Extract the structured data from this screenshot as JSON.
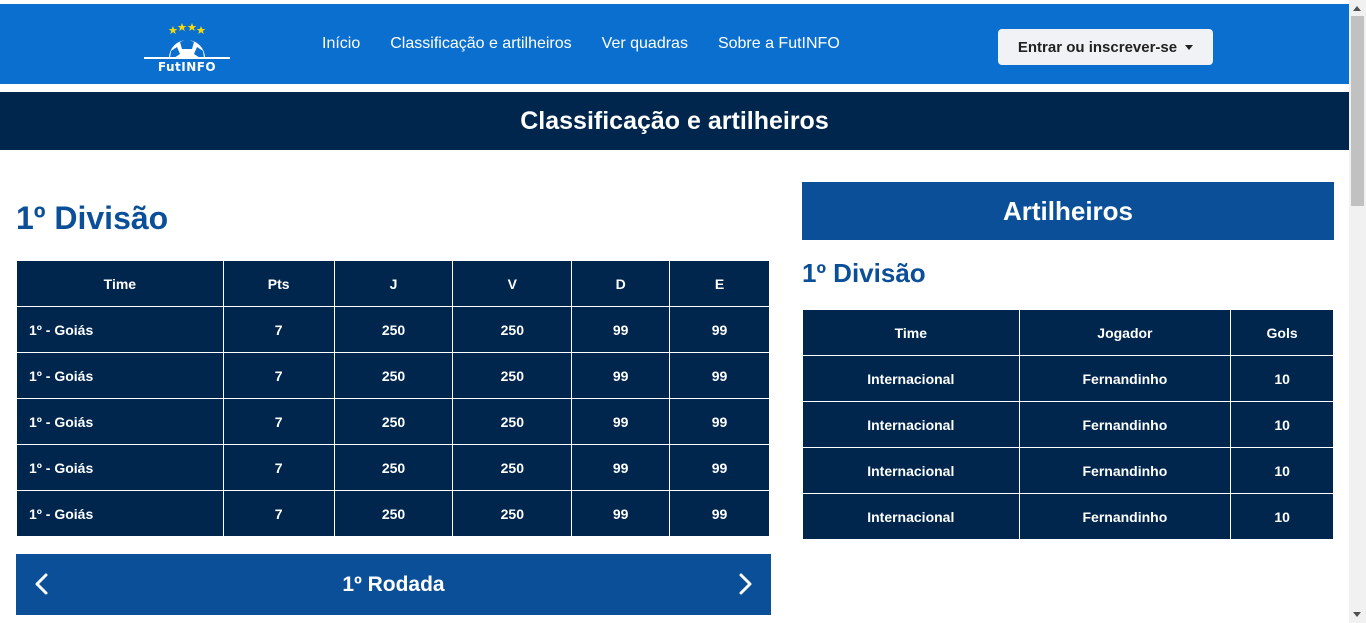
{
  "navbar": {
    "logo_text": "FutINFO",
    "links": [
      "Início",
      "Classificação e artilheiros",
      "Ver quadras",
      "Sobre a FutINFO"
    ],
    "login_label": "Entrar ou inscrever-se"
  },
  "page_title": "Classificação e artilheiros",
  "standings": {
    "division_title": "1º Divisão",
    "headers": [
      "Time",
      "Pts",
      "J",
      "V",
      "D",
      "E"
    ],
    "rows": [
      [
        "1º - Goiás",
        "7",
        "250",
        "250",
        "99",
        "99"
      ],
      [
        "1º - Goiás",
        "7",
        "250",
        "250",
        "99",
        "99"
      ],
      [
        "1º - Goiás",
        "7",
        "250",
        "250",
        "99",
        "99"
      ],
      [
        "1º - Goiás",
        "7",
        "250",
        "250",
        "99",
        "99"
      ],
      [
        "1º - Goiás",
        "7",
        "250",
        "250",
        "99",
        "99"
      ]
    ],
    "round_label": "1º Rodada"
  },
  "scorers": {
    "header": "Artilheiros",
    "division_title": "1º Divisão",
    "headers": [
      "Time",
      "Jogador",
      "Gols"
    ],
    "rows": [
      [
        "Internacional",
        "Fernandinho",
        "10"
      ],
      [
        "Internacional",
        "Fernandinho",
        "10"
      ],
      [
        "Internacional",
        "Fernandinho",
        "10"
      ],
      [
        "Internacional",
        "Fernandinho",
        "10"
      ]
    ]
  },
  "colors": {
    "navbar": "#0b6fd0",
    "title_bar": "#00264d",
    "accent": "#0b4f99",
    "table_bg": "#00264d"
  }
}
